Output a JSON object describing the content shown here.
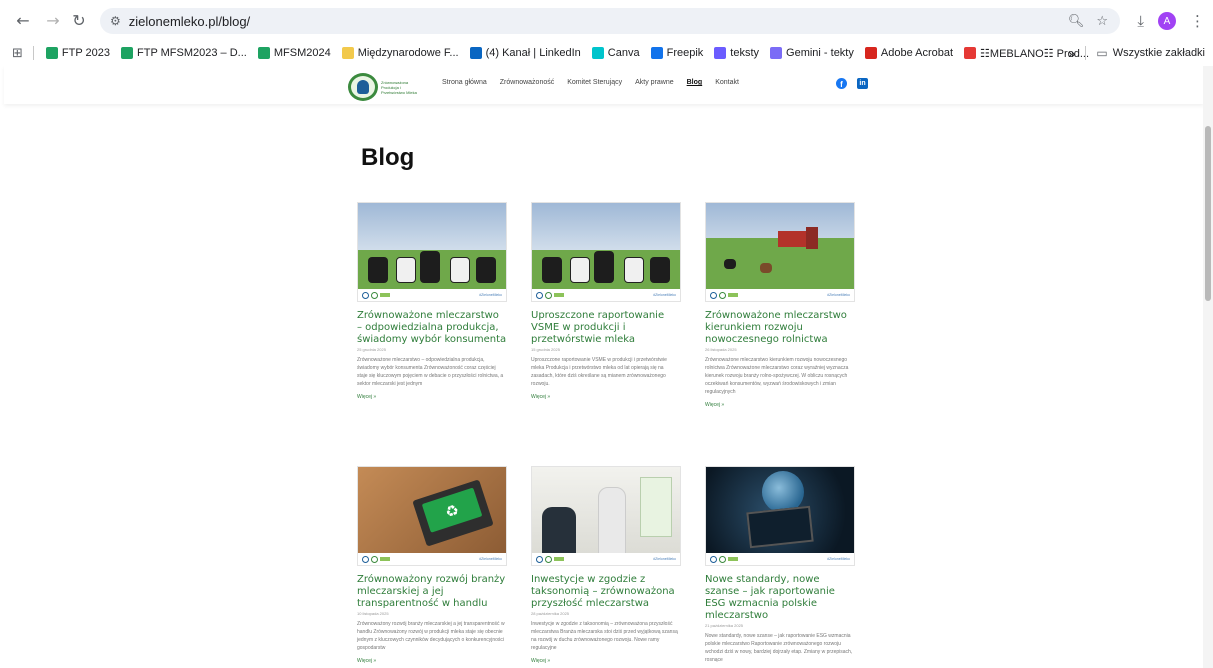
{
  "browser": {
    "url": "zielonemleko.pl/blog/",
    "profile_initial": "A",
    "bookmarks": [
      {
        "label": "FTP 2023",
        "color": "#1ea362"
      },
      {
        "label": "FTP MFSM2023 – D...",
        "color": "#1ea362"
      },
      {
        "label": "MFSM2024",
        "color": "#1ea362"
      },
      {
        "label": "Międzynarodowe F...",
        "color": "#f2c94c"
      },
      {
        "label": "(4) Kanał | LinkedIn",
        "color": "#0a66c2"
      },
      {
        "label": "Canva",
        "color": "#00c4cc"
      },
      {
        "label": "Freepik",
        "color": "#1273eb"
      },
      {
        "label": "teksty",
        "color": "#6b5cff"
      },
      {
        "label": "Gemini - tekty",
        "color": "#7b6cf6"
      },
      {
        "label": "Adobe Acrobat",
        "color": "#d7261e"
      },
      {
        "label": "☷MEBLANO☷ Prod...",
        "color": "#e53935"
      }
    ],
    "more_bookmarks": "»",
    "all_bookmarks": "Wszystkie zakładki"
  },
  "site": {
    "logo_text": "Zrównoważona Produkcja i Przetwórstwo Mleka",
    "nav": [
      {
        "label": "Strona główna",
        "active": false
      },
      {
        "label": "Zrównoważoność",
        "active": false
      },
      {
        "label": "Komitet Sterujący",
        "active": false
      },
      {
        "label": "Akty prawne",
        "active": false
      },
      {
        "label": "Blog",
        "active": true
      },
      {
        "label": "Kontakt",
        "active": false
      }
    ],
    "social": {
      "facebook": "f",
      "linkedin": "in"
    }
  },
  "page": {
    "title": "Blog",
    "thumb_tag": "#ZieloneMleko",
    "more_label": "Więcej »",
    "posts": [
      {
        "title": "Zrównoważone mleczarstwo – odpowiedzialna produkcja, świadomy wybór konsumenta",
        "date": "25 grudnia 2025",
        "excerpt": "Zrównoważone mleczarstwo – odpowiedzialna produkcja, świadomy wybór konsumenta Zrównoważoność coraz częściej staje się kluczowym pojęciem w debacie o przyszłości rolnictwa, a sektor mleczarski jest jednym",
        "image": "cows"
      },
      {
        "title": "Uproszczone raportowanie VSME w produkcji i przetwórstwie mleka",
        "date": "15 grudnia 2025",
        "excerpt": "Uproszczone raportowanie VSME w produkcji i przetwórstwie mleka Produkcja i przetwórstwo mleka od lat opierają się na zasadach, które dziś określane są mianem zrównoważonego rozwoju.",
        "image": "cows"
      },
      {
        "title": "Zrównoważone mleczarstwo kierunkiem rozwoju nowoczesnego rolnictwa",
        "date": "26 listopada 2025",
        "excerpt": "Zrównoważone mleczarstwo kierunkiem rozwoju nowoczesnego rolnictwa Zrównoważone mleczarstwo coraz wyraźniej wyznacza kierunek rozwoju branży rolno-spożywczej. W obliczu rosnących oczekiwań konsumentów, wyzwań środowiskowych i zmian regulacyjnych",
        "image": "farm"
      },
      {
        "title": "Zrównoważony rozwój branży mleczarskiej a jej transparentność w handlu",
        "date": "10 listopada 2025",
        "excerpt": "Zrównoważony rozwój branży mleczarskiej a jej transparentność w handlu Zrównoważony rozwój w produkcji mleka staje się obecnie jednym z kluczowych czynników decydujących o konkurencyjności gospodarstw",
        "image": "laptop"
      },
      {
        "title": "Inwestycje w zgodzie z taksonomią – zrównoważona przyszłość mleczarstwa",
        "date": "28 października 2025",
        "excerpt": "Inwestycje w zgodzie z taksonomią – zrównoważona przyszłość mleczarstwa Branża mleczarska stoi dziś przed wyjątkową szansą na rozwój w duchu zrównoważonego rozwoju. Nowe ramy regulacyjne",
        "image": "office"
      },
      {
        "title": "Nowe standardy, nowe szanse – jak raportowanie ESG wzmacnia polskie mleczarstwo",
        "date": "21 października 2025",
        "excerpt": "Nowe standardy, nowe szanse – jak raportowanie ESG wzmacnia polskie mleczarstwo Raportowanie zrównoważonego rozwoju wchodzi dziś w nowy, bardziej dojrzały etap. Zmiany w przepisach, rosnące",
        "image": "tablet"
      }
    ]
  }
}
